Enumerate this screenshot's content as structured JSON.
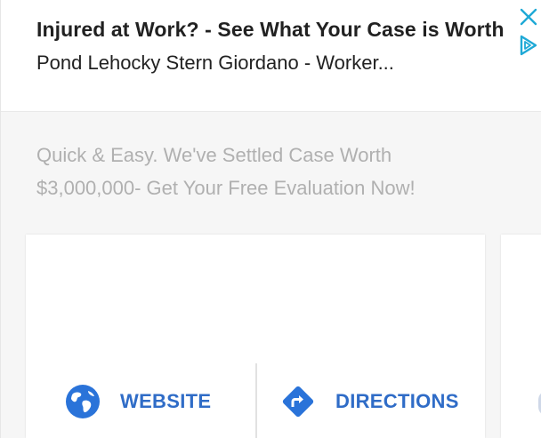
{
  "ad": {
    "headline": "Injured at Work? - See What Your Case is Worth",
    "advertiser": "Pond Lehocky Stern Giordano - Worker...",
    "description": "Quick & Easy. We've Settled Case Worth $3,000,000- Get Your Free Evaluation Now!",
    "actions": [
      {
        "label": "WEBSITE",
        "icon": "globe-icon"
      },
      {
        "label": "DIRECTIONS",
        "icon": "directions-icon"
      }
    ]
  },
  "colors": {
    "accent": "#2f6cc7",
    "icon_blue": "#2a73d9",
    "adchoices": "#1fa9d6",
    "headline": "#212121",
    "description": "#b0b0b0"
  }
}
